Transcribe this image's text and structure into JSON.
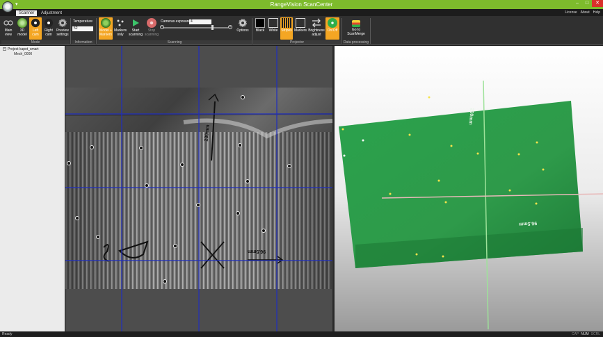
{
  "window": {
    "title": "RangeVision ScanCenter",
    "quick_access": "▾",
    "minimize": "–",
    "maximize": "□",
    "close": "✕"
  },
  "tabs": [
    {
      "label": "Scanner",
      "active": true
    },
    {
      "label": "Adjustment",
      "active": false
    }
  ],
  "help_links": [
    "License",
    "About",
    "Help"
  ],
  "ribbon": {
    "groups": {
      "mode": "Mode",
      "information": "Information",
      "scanning": "Scanning",
      "projector": "Projector",
      "data_processing": "Data processing"
    },
    "mode_buttons": [
      {
        "l1": "Main",
        "l2": "view",
        "icon": "eye-icon",
        "active": false
      },
      {
        "l1": "3D",
        "l2": "model",
        "icon": "globe-3d-icon",
        "active": false
      },
      {
        "l1": "Left",
        "l2": "cam",
        "icon": "left-camera-icon",
        "active": true
      },
      {
        "l1": "Right",
        "l2": "cam",
        "icon": "right-camera-icon",
        "active": false
      },
      {
        "l1": "Preview",
        "l2": "settings",
        "icon": "gear-icon",
        "active": false
      }
    ],
    "temperature_label": "Temperature",
    "temperature_value": "52",
    "scan_buttons": [
      {
        "l1": "Model +",
        "l2": "Markers",
        "icon": "model-markers-icon",
        "active": true
      },
      {
        "l1": "Markers",
        "l2": "only",
        "icon": "markers-icon",
        "active": false
      },
      {
        "l1": "Start",
        "l2": "scanning",
        "icon": "play-icon",
        "active": false
      },
      {
        "l1": "Stop",
        "l2": "scanning",
        "icon": "stop-icon",
        "active": false
      }
    ],
    "exposure_label": "Cameras exposure",
    "exposure_value": "4",
    "exposure_level": 0.75,
    "options_label": "Options",
    "projector_buttons": [
      {
        "l1": "Black",
        "l2": "",
        "icon": "black-square-icon",
        "active": false
      },
      {
        "l1": "White",
        "l2": "",
        "icon": "white-square-icon",
        "active": false
      },
      {
        "l1": "Stripes",
        "l2": "",
        "icon": "stripes-icon",
        "active": true
      },
      {
        "l1": "Markers",
        "l2": "",
        "icon": "markers-square-icon",
        "active": false
      },
      {
        "l1": "Brightness",
        "l2": "adjust",
        "icon": "brightness-icon",
        "active": false
      },
      {
        "l1": "On/Off",
        "l2": "",
        "icon": "power-icon",
        "active": true
      }
    ],
    "goto_l1": "Go to",
    "goto_l2": "ScanMerge"
  },
  "tree": {
    "project": "Project kapot_smart",
    "mesh": "Mesh_0000",
    "expand_glyph": "−"
  },
  "cam_annotation": "96.5mm",
  "cam_annotation2": "230mm",
  "scan_annotation": "96.5mm",
  "scan_annotation2": "230mm",
  "status": {
    "ready": "Ready",
    "caps": "CAP",
    "num": "NUM",
    "scrl": "SCRL"
  },
  "colors": {
    "title_green": "#7dbb2c",
    "active_orange": "#f4a623",
    "scan_green": "#2e9a4a",
    "grid_blue": "#1f2dbf"
  }
}
